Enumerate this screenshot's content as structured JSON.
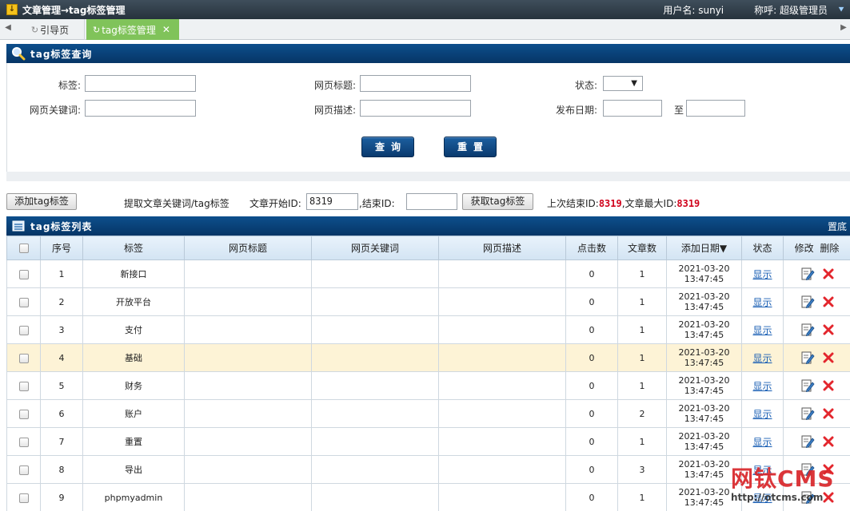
{
  "titlebar": {
    "breadcrumb": "文章管理→tag标签管理",
    "username": "用户名: sunyi",
    "role": "称呼: 超级管理员"
  },
  "tabs": [
    {
      "label": "引导页"
    },
    {
      "label": "tag标签管理"
    }
  ],
  "query": {
    "title": "tag标签查询",
    "labels": {
      "tag": "标签:",
      "page_title": "网页标题:",
      "status": "状态:",
      "keywords": "网页关键词:",
      "description": "网页描述:",
      "publish_date": "发布日期:",
      "to": "至"
    },
    "buttons": {
      "search": "查询",
      "reset": "重置"
    }
  },
  "toolbar": {
    "add_button": "添加tag标签",
    "extract_text": "提取文章关键词/tag标签",
    "start_id_label": "文章开始ID:",
    "start_id_value": "8319",
    "end_id_label": ",结束ID:",
    "end_id_value": "",
    "fetch_button": "获取tag标签",
    "last_end_label": "上次结束ID:",
    "last_end_value": "8319",
    "max_id_label": ",文章最大ID:",
    "max_id_value": "8319"
  },
  "list": {
    "title": "tag标签列表",
    "to_bottom": "置底",
    "columns": [
      "序号",
      "标签",
      "网页标题",
      "网页关键词",
      "网页描述",
      "点击数",
      "文章数",
      "添加日期▼",
      "状态",
      "修改",
      "删除"
    ],
    "rows": [
      {
        "no": "1",
        "tag": "新接口",
        "title": "",
        "keywords": "",
        "desc": "",
        "clicks": "0",
        "articles": "1",
        "date": "2021-03-20",
        "time": "13:47:45",
        "status": "显示"
      },
      {
        "no": "2",
        "tag": "开放平台",
        "title": "",
        "keywords": "",
        "desc": "",
        "clicks": "0",
        "articles": "1",
        "date": "2021-03-20",
        "time": "13:47:45",
        "status": "显示"
      },
      {
        "no": "3",
        "tag": "支付",
        "title": "",
        "keywords": "",
        "desc": "",
        "clicks": "0",
        "articles": "1",
        "date": "2021-03-20",
        "time": "13:47:45",
        "status": "显示"
      },
      {
        "no": "4",
        "tag": "基础",
        "title": "",
        "keywords": "",
        "desc": "",
        "clicks": "0",
        "articles": "1",
        "date": "2021-03-20",
        "time": "13:47:45",
        "status": "显示"
      },
      {
        "no": "5",
        "tag": "财务",
        "title": "",
        "keywords": "",
        "desc": "",
        "clicks": "0",
        "articles": "1",
        "date": "2021-03-20",
        "time": "13:47:45",
        "status": "显示"
      },
      {
        "no": "6",
        "tag": "账户",
        "title": "",
        "keywords": "",
        "desc": "",
        "clicks": "0",
        "articles": "2",
        "date": "2021-03-20",
        "time": "13:47:45",
        "status": "显示"
      },
      {
        "no": "7",
        "tag": "重置",
        "title": "",
        "keywords": "",
        "desc": "",
        "clicks": "0",
        "articles": "1",
        "date": "2021-03-20",
        "time": "13:47:45",
        "status": "显示"
      },
      {
        "no": "8",
        "tag": "导出",
        "title": "",
        "keywords": "",
        "desc": "",
        "clicks": "0",
        "articles": "3",
        "date": "2021-03-20",
        "time": "13:47:45",
        "status": "显示"
      },
      {
        "no": "9",
        "tag": "phpmyadmin",
        "title": "",
        "keywords": "",
        "desc": "",
        "clicks": "0",
        "articles": "1",
        "date": "2021-03-20",
        "time": "13:47:45",
        "status": "显示"
      }
    ]
  },
  "watermark": {
    "logo": "网钛CMS",
    "url": "http://otcms.com"
  },
  "colors": {
    "header_blue": "#0a3f78",
    "active_tab": "#80c35a",
    "highlight_row": "#fdf3d6",
    "red_number": "#d0021b"
  }
}
